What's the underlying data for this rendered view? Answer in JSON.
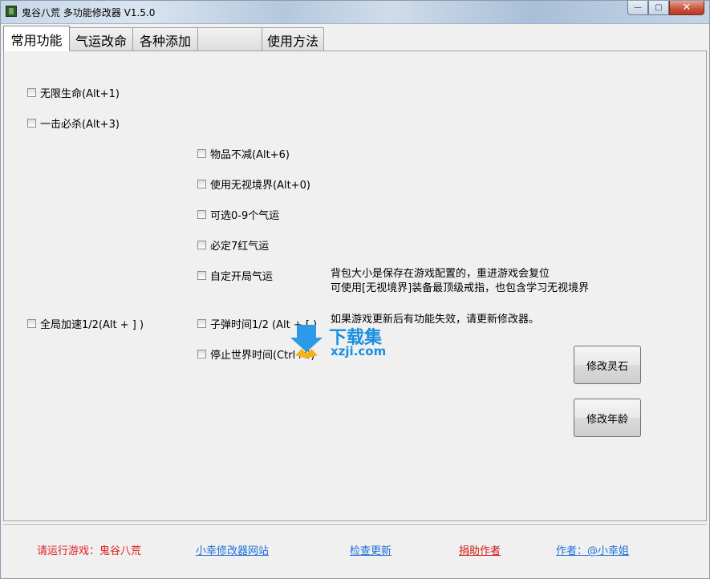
{
  "window": {
    "title": "鬼谷八荒 多功能修改器  V1.5.0",
    "controls": {
      "minimize": "—",
      "maximize": "▢",
      "close": "✕"
    }
  },
  "tabs": [
    {
      "label": "常用功能",
      "active": true
    },
    {
      "label": "气运改命",
      "active": false
    },
    {
      "label": "各种添加",
      "active": false
    },
    {
      "label": "",
      "active": false
    },
    {
      "label": "使用方法",
      "active": false
    }
  ],
  "checkboxes": {
    "infinite_life": "无限生命(Alt+1)",
    "one_hit_kill": "一击必杀(Alt+3)",
    "items_no_decrease": "物品不减(Alt+6)",
    "ignore_realm": "使用无视境界(Alt+0)",
    "choose_luck": "可选0-9个气运",
    "seven_red_luck": "必定7红气运",
    "custom_start_luck": "自定开局气运",
    "global_speed": "全局加速1/2(Alt + ] )",
    "bullet_time": "子弹时间1/2 (Alt + [ )",
    "stop_world_time": "停止世界时间(Ctrl+0)"
  },
  "notes": {
    "line1": "背包大小是保存在游戏配置的，重进游戏会复位",
    "line2": "可使用[无视境界]装备最顶级戒指，也包含学习无视境界",
    "line3": "如果游戏更新后有功能失效，请更新修改器。"
  },
  "buttons": {
    "modify_spirit_stone": "修改灵石",
    "modify_age": "修改年龄"
  },
  "watermark": {
    "title": "下载集",
    "subtitle": "xzji.com"
  },
  "footer": {
    "status": "请运行游戏：鬼谷八荒",
    "site_link": "小幸修改器网站",
    "check_update": "检查更新",
    "donate": "捐助作者",
    "author": "作者：@小幸姐"
  },
  "colors": {
    "status_red": "#e02020",
    "link_blue": "#1e6fd9",
    "donate_red": "#d01818",
    "watermark_blue": "#1a8fe0"
  }
}
